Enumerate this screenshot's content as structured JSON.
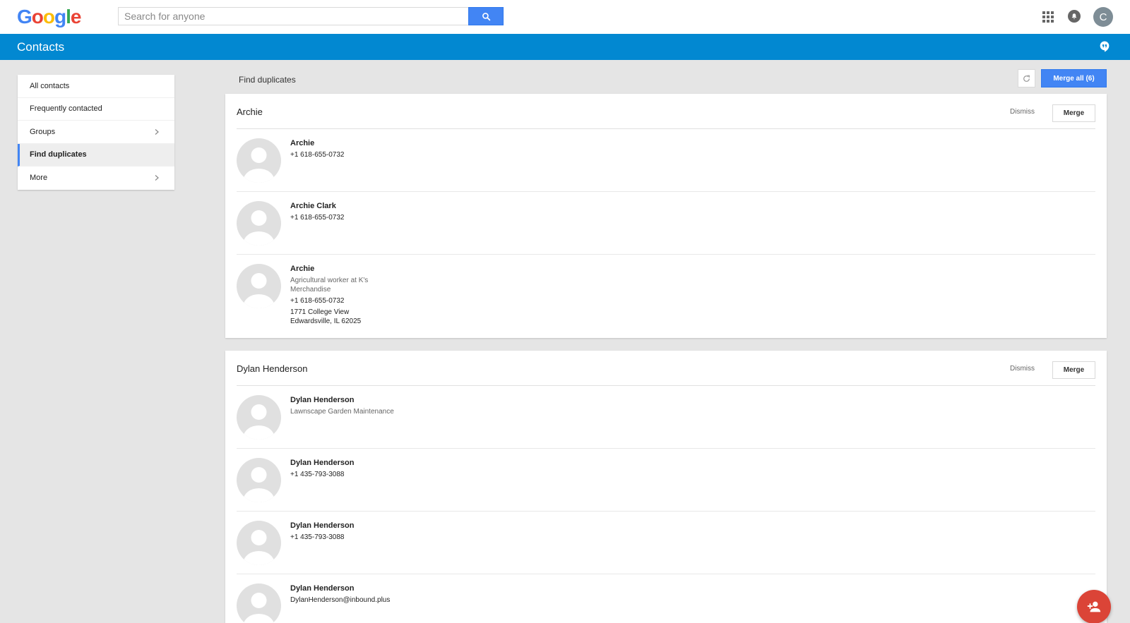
{
  "header": {
    "logo_text": "Google",
    "search": {
      "placeholder": "Search for anyone",
      "value": ""
    },
    "avatar_initial": "C"
  },
  "appbar": {
    "title": "Contacts"
  },
  "sidebar": {
    "items": [
      {
        "label": "All contacts",
        "active": false,
        "has_submenu": false
      },
      {
        "label": "Frequently contacted",
        "active": false,
        "has_submenu": false
      },
      {
        "label": "Groups",
        "active": false,
        "has_submenu": true
      },
      {
        "label": "Find duplicates",
        "active": true,
        "has_submenu": false
      },
      {
        "label": "More",
        "active": false,
        "has_submenu": true
      }
    ]
  },
  "main": {
    "section_title": "Find duplicates",
    "merge_all_label": "Merge all (6)",
    "groups": [
      {
        "name": "Archie",
        "dismiss_label": "Dismiss",
        "merge_label": "Merge",
        "contacts": [
          {
            "name": "Archie",
            "phone": "+1 618-655-0732"
          },
          {
            "name": "Archie Clark",
            "phone": "+1 618-655-0732"
          },
          {
            "name": "Archie",
            "job": "Agricultural worker at K's\nMerchandise",
            "phone": "+1 618-655-0732",
            "address": "1771 College View\nEdwardsville, IL 62025"
          }
        ]
      },
      {
        "name": "Dylan Henderson",
        "dismiss_label": "Dismiss",
        "merge_label": "Merge",
        "contacts": [
          {
            "name": "Dylan Henderson",
            "job": "Lawnscape Garden Maintenance"
          },
          {
            "name": "Dylan Henderson",
            "phone": "+1 435-793-3088"
          },
          {
            "name": "Dylan Henderson",
            "phone": "+1 435-793-3088"
          },
          {
            "name": "Dylan Henderson",
            "email": "DylanHenderson@inbound.plus"
          }
        ]
      }
    ]
  },
  "colors": {
    "brand_blue": "#0288d1",
    "button_blue": "#4285f4",
    "fab_red": "#db4437"
  },
  "icons": [
    "search-icon",
    "apps-icon",
    "notifications-icon",
    "hangouts-icon",
    "chevron-right-icon",
    "refresh-icon",
    "person-placeholder-icon",
    "add-person-icon"
  ]
}
